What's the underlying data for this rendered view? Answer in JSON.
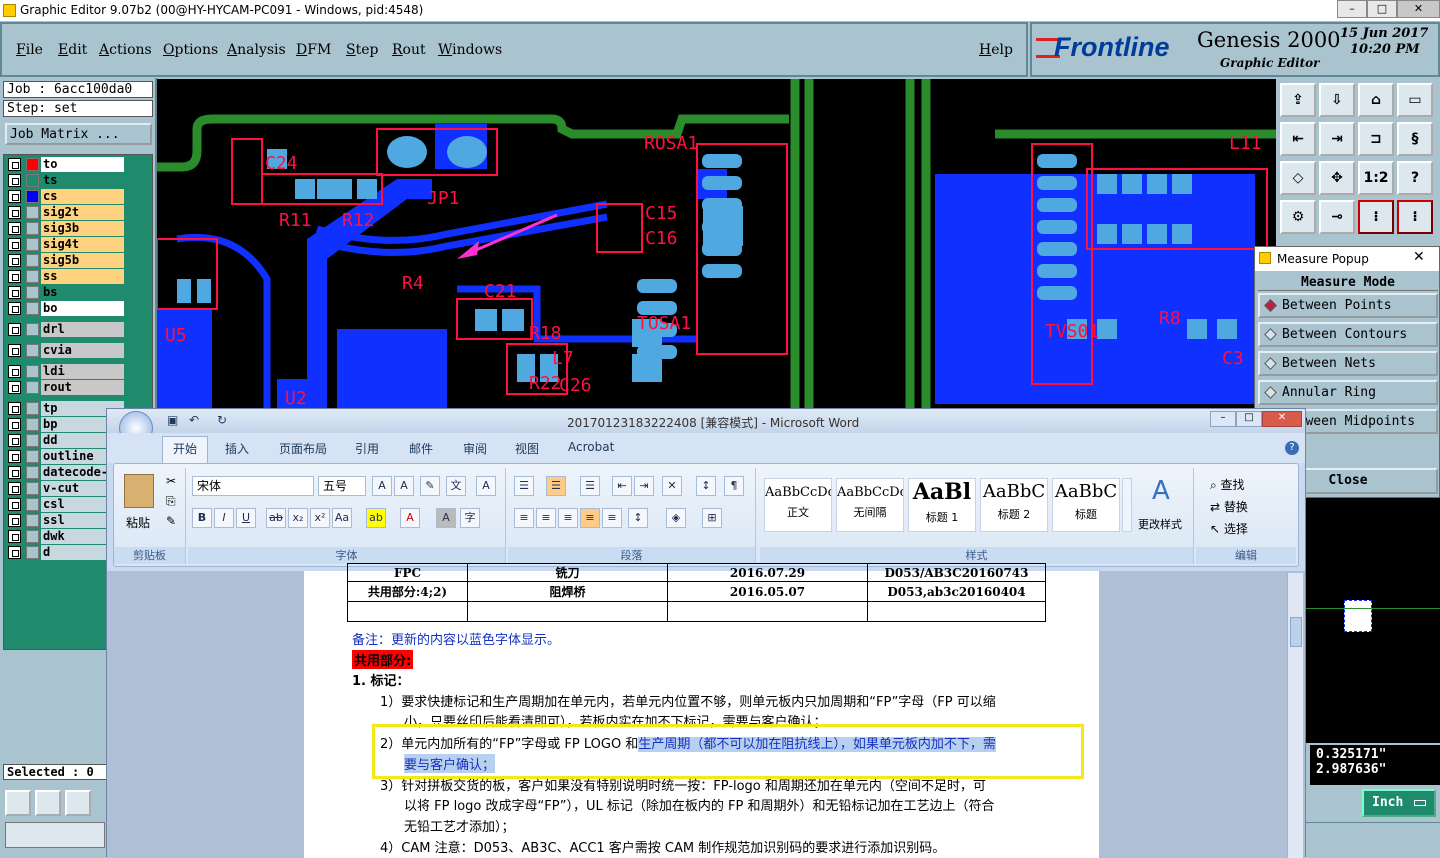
{
  "window": {
    "title": "Graphic Editor 9.07b2 (00@HY-HYCAM-PC091 - Windows, pid:4548)"
  },
  "menu": {
    "items": [
      "File",
      "Edit",
      "Actions",
      "Options",
      "Analysis",
      "DFM",
      "Step",
      "Rout",
      "Windows"
    ],
    "help": "Help"
  },
  "brand": {
    "logo": "Frontline",
    "product": "Genesis 2000",
    "subtitle": "Graphic Editor",
    "date": "15 Jun 2017",
    "time": "10:20 PM"
  },
  "job": {
    "job_label": "Job : 6acc100da0",
    "step_label": "Step: set",
    "matrix_button": "Job Matrix ..."
  },
  "layers": [
    {
      "name": "to",
      "color": "#ffffff",
      "swatch": "#ff0000"
    },
    {
      "name": "ts",
      "color": "#1f8a6c",
      "swatch": "#1f8a6c"
    },
    {
      "name": "cs",
      "color": "#ffd27f",
      "swatch": "#0000ff"
    },
    {
      "name": "sig2t",
      "color": "#ffd27f",
      "swatch": "#a9c3cf"
    },
    {
      "name": "sig3b",
      "color": "#ffd27f",
      "swatch": "#a9c3cf"
    },
    {
      "name": "sig4t",
      "color": "#ffd27f",
      "swatch": "#a9c3cf"
    },
    {
      "name": "sig5b",
      "color": "#ffd27f",
      "swatch": "#a9c3cf"
    },
    {
      "name": "ss",
      "color": "#ffd27f",
      "swatch": "#a9c3cf"
    },
    {
      "name": "bs",
      "color": "#1f8a6c",
      "swatch": "#a9c3cf"
    },
    {
      "name": "bo",
      "color": "#ffffff",
      "swatch": "#a9c3cf"
    },
    {
      "name": "drl",
      "color": "#c8c8c8",
      "swatch": "#a9c3cf"
    },
    {
      "name": "cvia",
      "color": "#c8c8c8",
      "swatch": "#a9c3cf"
    },
    {
      "name": "ldi",
      "color": "#c8c8c8",
      "swatch": "#a9c3cf"
    },
    {
      "name": "rout",
      "color": "#c8c8c8",
      "swatch": "#a9c3cf"
    },
    {
      "name": "tp",
      "color": "#c8d8e0",
      "swatch": "#a9c3cf"
    },
    {
      "name": "bp",
      "color": "#c8d8e0",
      "swatch": "#a9c3cf"
    },
    {
      "name": "dd",
      "color": "#c8d8e0",
      "swatch": "#a9c3cf"
    },
    {
      "name": "outline",
      "color": "#c8d8e0",
      "swatch": "#a9c3cf"
    },
    {
      "name": "datecode-",
      "color": "#c8d8e0",
      "swatch": "#a9c3cf"
    },
    {
      "name": "v-cut",
      "color": "#c8d8e0",
      "swatch": "#a9c3cf"
    },
    {
      "name": "csl",
      "color": "#c8d8e0",
      "swatch": "#a9c3cf"
    },
    {
      "name": "ssl",
      "color": "#c8d8e0",
      "swatch": "#a9c3cf"
    },
    {
      "name": "dwk",
      "color": "#c8d8e0",
      "swatch": "#a9c3cf"
    },
    {
      "name": "d",
      "color": "#c8d8e0",
      "swatch": "#a9c3cf"
    }
  ],
  "status": {
    "selected": "Selected : 0"
  },
  "pcb_labels": {
    "c24": "C24",
    "r11": "R11",
    "r12": "R12",
    "jp1": "JP1",
    "rosa1": "ROSA1",
    "c15": "C15",
    "c16": "C16",
    "r4": "R4",
    "c21": "C21",
    "tosa1": "TOSA1",
    "r18": "R18",
    "l7": "L7",
    "r22": "R22",
    "c26": "C26",
    "u5": "U5",
    "u2": "U2",
    "tvs01": "TVS01",
    "l11": "L11",
    "r8": "R8",
    "c3": "C3"
  },
  "measure": {
    "title": "Measure Popup",
    "mode_label": "Measure Mode",
    "options": [
      "Between Points",
      "Between Contours",
      "Between Nets",
      "Annular Ring",
      "Between Midpoints"
    ],
    "close": "Close"
  },
  "coords": {
    "x": "0.325171\"",
    "y": "2.987636\"",
    "units": "Inch"
  },
  "word": {
    "title": "20170123183222408 [兼容模式] - Microsoft Word",
    "tabs": [
      "开始",
      "插入",
      "页面布局",
      "引用",
      "邮件",
      "审阅",
      "视图",
      "Acrobat"
    ],
    "font": "宋体",
    "size": "五号",
    "clipboard": {
      "paste": "粘贴",
      "label": "剪贴板"
    },
    "font_group_label": "字体",
    "para_label": "段落",
    "styles_label": "样式",
    "edit_label": "编辑",
    "styles": [
      {
        "sample": "AaBbCcDc",
        "name": "正文"
      },
      {
        "sample": "AaBbCcDc",
        "name": "无间隔"
      },
      {
        "sample": "AaBl",
        "name": "标题 1"
      },
      {
        "sample": "AaBbC",
        "name": "标题 2"
      },
      {
        "sample": "AaBbC",
        "name": "标题"
      }
    ],
    "change_styles": "更改样式",
    "edit": {
      "find": "查找",
      "replace": "替换",
      "select": "选择"
    },
    "table": {
      "row0": [
        "FPC",
        "铣刀",
        "2016.07.29",
        "D053/AB3C20160743"
      ],
      "row1": [
        "共用部分:4;2)",
        "阻焊桥",
        "2016.05.07",
        "D053,ab3c20160404"
      ]
    },
    "doc": {
      "note": "备注：更新的内容以蓝色字体显示。",
      "heading": "共用部分:",
      "item1": "1.   标记：",
      "p1a": "1）要求快捷标记和生产周期加在单元内，若单元内位置不够，则单元板内只加周期和“FP”字母（FP 可以缩",
      "p1b": "小，只要丝印后能看清即可），若板内实在加不下标记，需要与客户确认；",
      "p2a_plain": "2）单元内加所有的“FP”字母或 FP LOGO 和",
      "p2a_hl": "生产周期（都不可以加在阻抗线上），如果单元板内加不下，需",
      "p2b": "要与客户确认；",
      "p3a": "3）针对拼板交货的板，客户如果没有特别说明时统一按：FP-logo 和周期还加在单元内（空间不足时，可",
      "p3b": "以将 FP logo 改成字母“FP”），UL 标记（除加在板内的 FP 和周期外）和无铅标记加在工艺边上（符合",
      "p3c": "无铅工艺才添加）；",
      "p4": "4）CAM 注意：D053、AB3C、ACC1 客户需按 CAM 制作规范加识别码的要求进行添加识别码。"
    }
  }
}
